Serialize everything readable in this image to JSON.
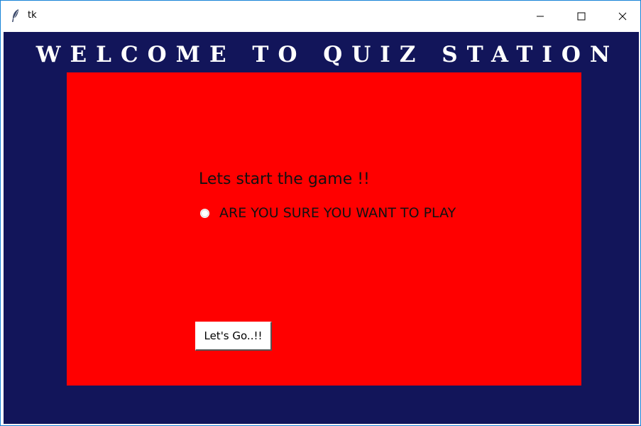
{
  "window": {
    "title": "tk",
    "controls": {
      "minimize_icon": "minimize-icon",
      "maximize_icon": "maximize-icon",
      "close_icon": "close-icon"
    }
  },
  "app": {
    "heading": "WELCOME TO QUIZ STATION",
    "prompt": "Lets start the game !!",
    "confirm_option": "ARE YOU SURE YOU WANT TO PLAY",
    "go_button": "Let's Go..!!"
  },
  "colors": {
    "background": "#12155a",
    "panel": "#ff0000",
    "heading": "#ffffff"
  }
}
